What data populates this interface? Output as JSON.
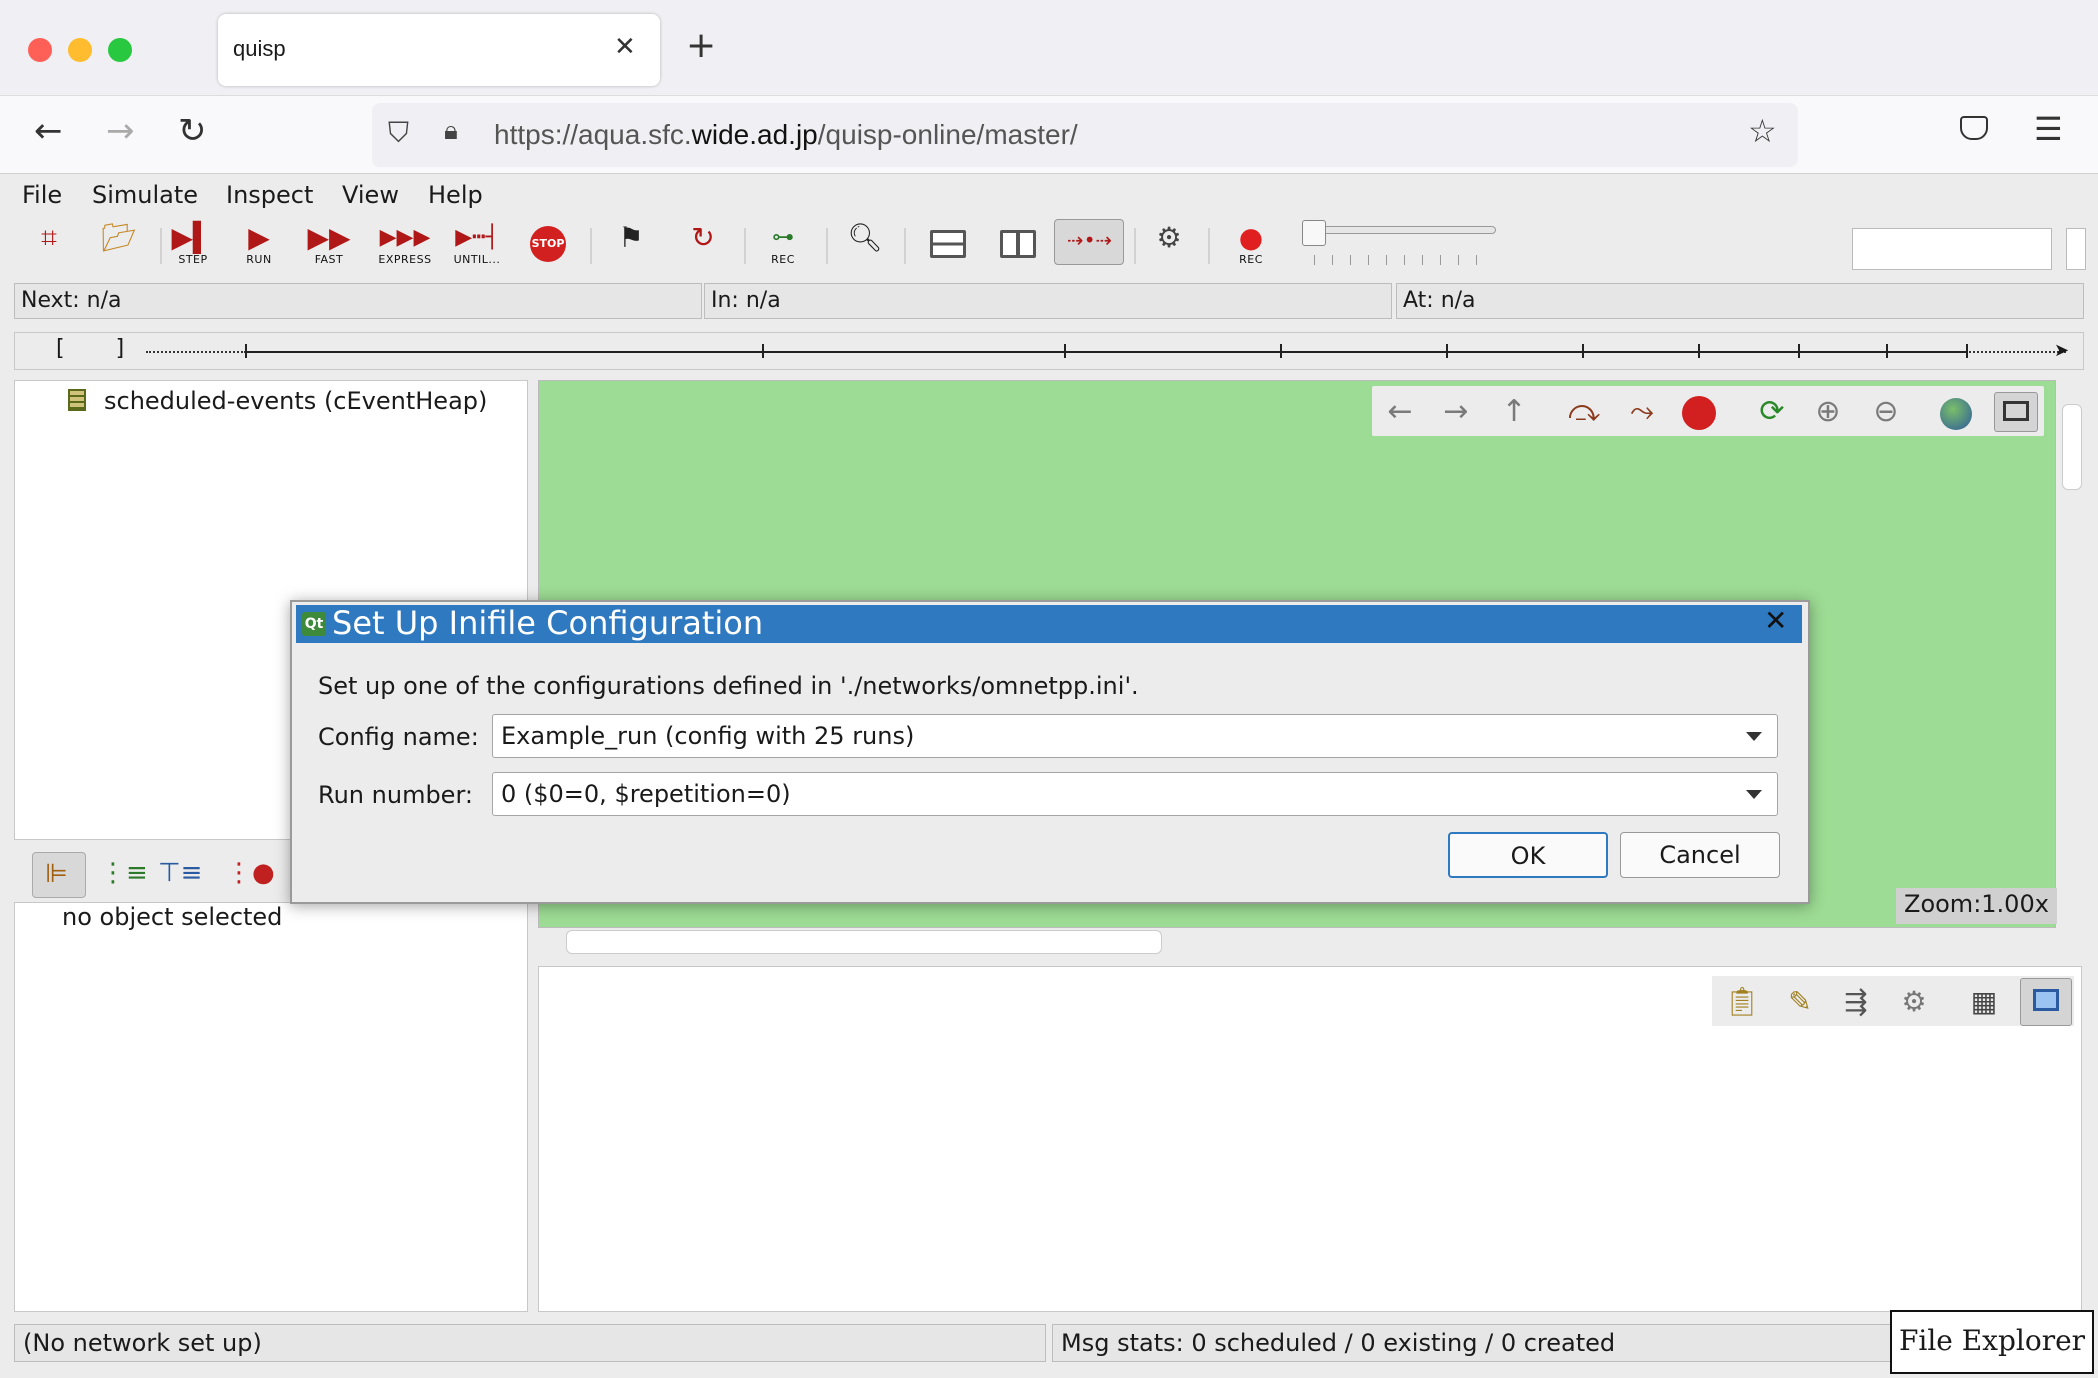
{
  "browser": {
    "tab_title": "quisp",
    "tab_close": "✕",
    "new_tab": "+",
    "url_prefix": "https://aqua.sfc.",
    "url_domain": "wide.ad.jp",
    "url_path": "/quisp-online/master/"
  },
  "menu": {
    "file": "File",
    "simulate": "Simulate",
    "inspect": "Inspect",
    "view": "View",
    "help": "Help"
  },
  "toolbar": {
    "step": "STEP",
    "run": "RUN",
    "fast": "FAST",
    "express": "EXPRESS",
    "until": "UNTIL...",
    "stop": "STOP",
    "rec": "REC",
    "rec2": "REC"
  },
  "status": {
    "next": "Next: n/a",
    "in": "In: n/a",
    "at": "At: n/a"
  },
  "timeline": {
    "brackets": "[ ]"
  },
  "object_tree": {
    "item": "scheduled-events (cEventHeap)"
  },
  "inspector": {
    "empty_text": "no object selected"
  },
  "canvas": {
    "zoom": "Zoom:1.00x",
    "background": "#9ddc94"
  },
  "bottom": {
    "network_status": "(No network set up)",
    "msg_stats": "Msg stats: 0 scheduled / 0 existing / 0 created",
    "file_explorer": "File Explorer"
  },
  "dialog": {
    "title": "Set Up Inifile Configuration",
    "message": "Set up one of the configurations defined in './networks/omnetpp.ini'.",
    "config_label": "Config name:",
    "config_value": "Example_run (config with 25 runs)",
    "run_label": "Run number:",
    "run_value": "0 ($0=0, $repetition=0)",
    "ok": "OK",
    "cancel": "Cancel",
    "title_bar_color": "#2f79c0"
  }
}
